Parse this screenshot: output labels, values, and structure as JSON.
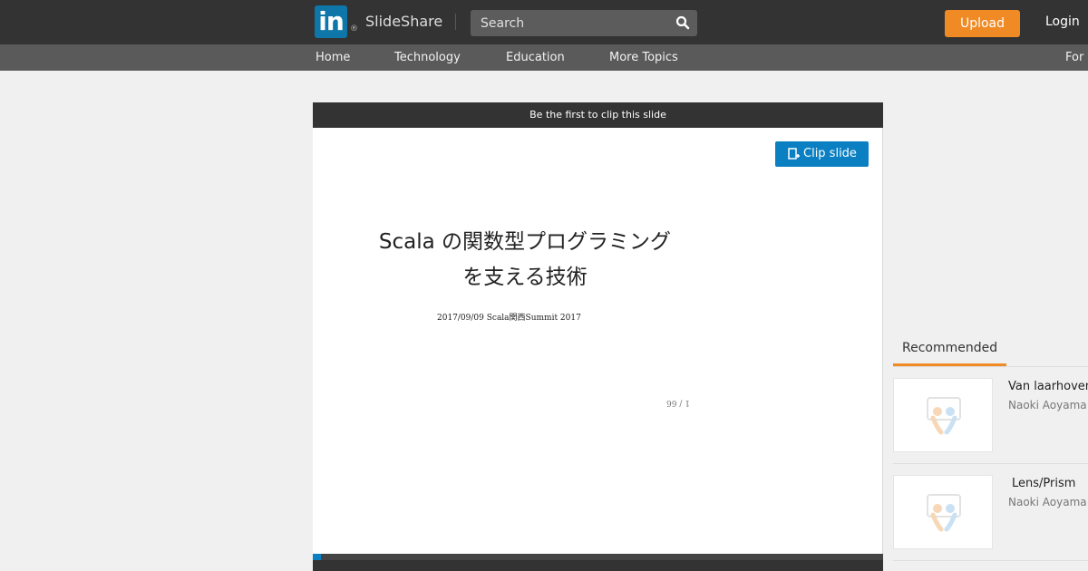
{
  "header": {
    "logo_text": "in",
    "logo_reg": "®",
    "brand": "SlideShare",
    "search_placeholder": "Search",
    "upload_label": "Upload",
    "login_label": "Login"
  },
  "nav": {
    "items": [
      "Home",
      "Technology",
      "Education",
      "More Topics",
      "For"
    ]
  },
  "slide": {
    "clip_banner": "Be the first to clip this slide",
    "clip_button": "Clip slide",
    "title_line1": "Scala の関数型プログラミング",
    "title_line2": "を支える技術",
    "subtitle": "2017/09/09 Scala関西Summit 2017",
    "page_indicator": "1 / 66",
    "progress": 0.015
  },
  "recommended": {
    "tab_label": "Recommended",
    "items": [
      {
        "title": "Van laarhoven",
        "author": "Naoki Aoyama"
      },
      {
        "title": "Lens/Prism",
        "author": "Naoki Aoyama"
      }
    ]
  },
  "colors": {
    "topbar": "#333333",
    "navbar": "#5a5a5a",
    "accent_orange": "#f08a24",
    "accent_blue": "#0a7fc2",
    "linkedin_blue": "#0e76a8"
  }
}
